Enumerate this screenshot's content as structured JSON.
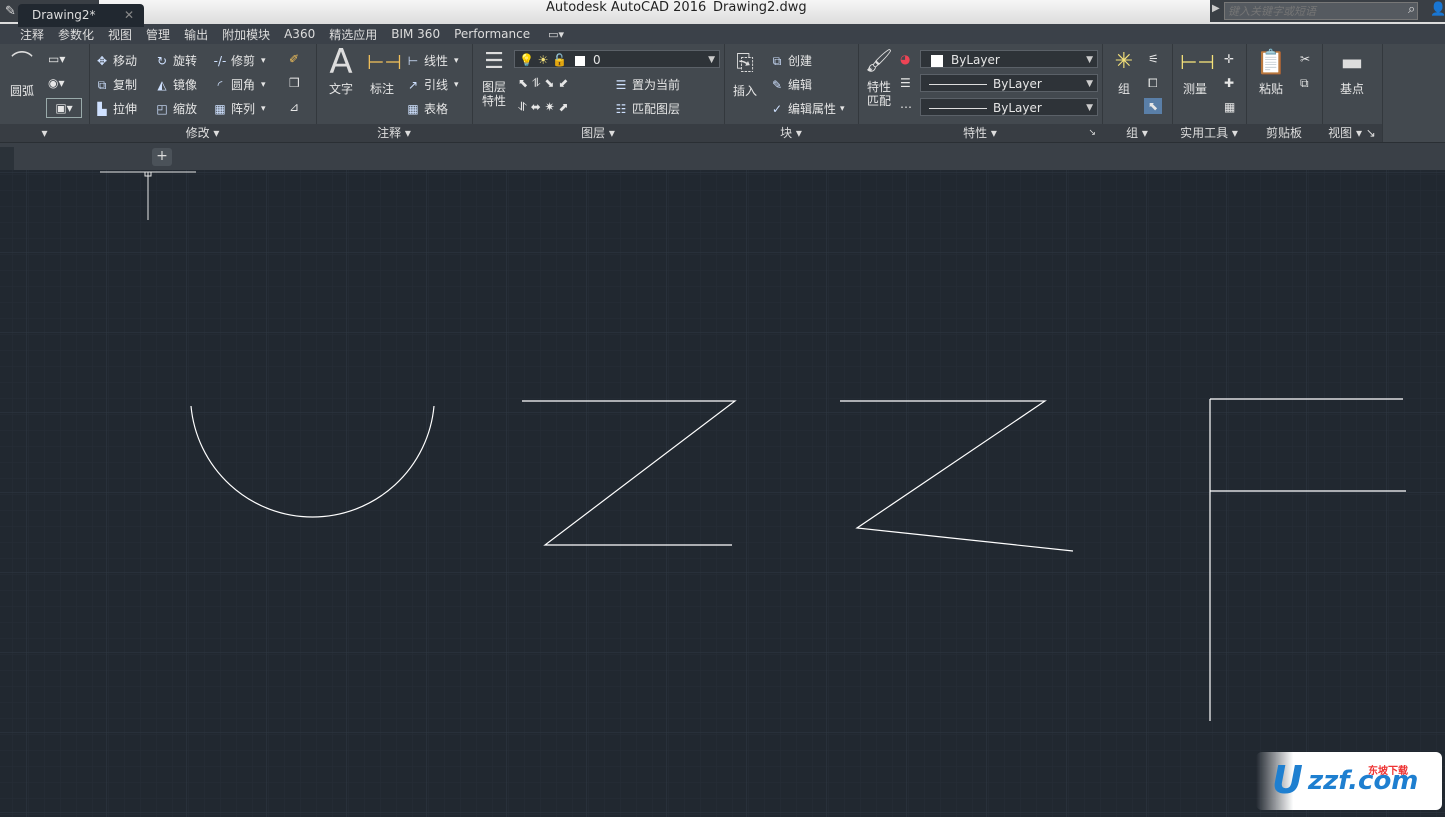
{
  "window": {
    "title": "Autodesk AutoCAD 2016",
    "file": "Drawing2.dwg",
    "search_placeholder": "键入关键字或短语"
  },
  "ribbon_tabs": [
    "注释",
    "参数化",
    "视图",
    "管理",
    "输出",
    "附加模块",
    "A360",
    "精选应用",
    "BIM 360",
    "Performance"
  ],
  "draw_panel": {
    "arc_label": "圆弧"
  },
  "modify_panel": {
    "label": "修改",
    "move": "移动",
    "rotate": "旋转",
    "trim": "修剪",
    "copy": "复制",
    "mirror": "镜像",
    "fillet": "圆角",
    "stretch": "拉伸",
    "scale": "缩放",
    "array": "阵列"
  },
  "annotation_panel": {
    "label": "注释",
    "text": "文字",
    "dimension": "标注",
    "linear": "线性",
    "leader": "引线",
    "table": "表格"
  },
  "layers_panel": {
    "label": "图层",
    "properties_line1": "图层",
    "properties_line2": "特性",
    "current_layer": "0",
    "set_current": "置为当前",
    "match_layer": "匹配图层"
  },
  "block_panel": {
    "label": "块",
    "insert": "插入",
    "create": "创建",
    "edit": "编辑",
    "edit_attributes": "编辑属性"
  },
  "properties_panel": {
    "label": "特性",
    "match_line1": "特性",
    "match_line2": "匹配",
    "color": "ByLayer",
    "linetype": "ByLayer",
    "lineweight": "ByLayer"
  },
  "groups_panel": {
    "label": "组",
    "group": "组"
  },
  "utilities_panel": {
    "label": "实用工具",
    "measure": "测量"
  },
  "clipboard_panel": {
    "label": "剪贴板",
    "paste": "粘贴"
  },
  "view_panel": {
    "label": "视图",
    "base": "基点"
  },
  "document_tabs": [
    {
      "name": "Drawing2*"
    }
  ],
  "watermark": {
    "letter": "U",
    "text": "zzf.com",
    "tag": "东坡下载"
  },
  "colors": {
    "background": "#212830",
    "ribbon": "#43494f",
    "geometry": "#ffffff",
    "grid": "#2c343d"
  }
}
